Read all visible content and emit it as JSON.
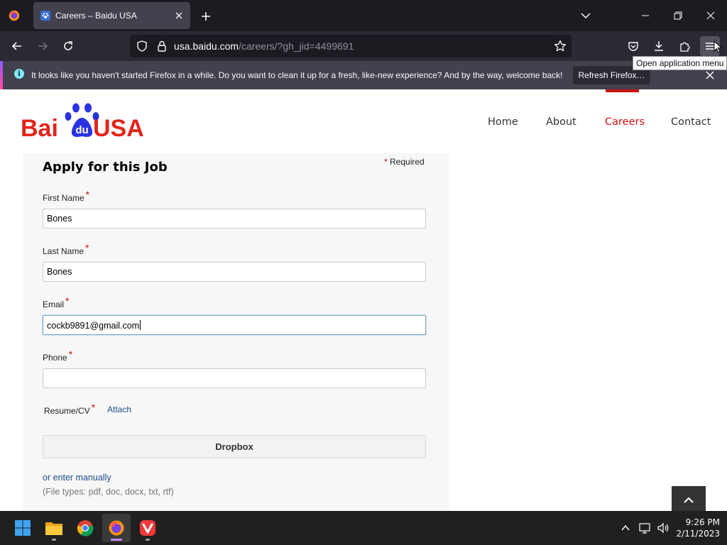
{
  "browser": {
    "tab": {
      "title": "Careers – Baidu USA",
      "favicon": "baidu-paw-icon"
    },
    "url": {
      "host": "usa.baidu.com",
      "path": "/careers/?gh_jid=4499691"
    },
    "tooltip": "Open application menu",
    "notification": {
      "message": "It looks like you haven't started Firefox in a while. Do you want to clean it up for a fresh, like-new experience? And by the way, welcome back!",
      "button": "Refresh Firefox…"
    }
  },
  "site": {
    "logo": {
      "part1": "Bai",
      "part2": "du",
      "part3": "USA"
    },
    "nav": [
      {
        "label": "Home"
      },
      {
        "label": "About"
      },
      {
        "label": "Careers",
        "active": true
      },
      {
        "label": "Contact"
      }
    ]
  },
  "form": {
    "title": "Apply for this Job",
    "required_star": "*",
    "required_label": "Required",
    "fields": [
      {
        "label": "First Name",
        "value": "Bones"
      },
      {
        "label": "Last Name",
        "value": "Bones"
      },
      {
        "label": "Email",
        "value": "cockb9891@gmail.com",
        "focused": true
      },
      {
        "label": "Phone",
        "value": ""
      }
    ],
    "resume": {
      "label": "Resume/CV",
      "attach": "Attach"
    },
    "dropbox": "Dropbox",
    "manual_link": "or enter manually",
    "file_types": "(File types: pdf, doc, docx, txt, rtf)"
  },
  "taskbar": {
    "apps": [
      "start-icon",
      "file-explorer-icon",
      "chrome-icon",
      "firefox-icon",
      "vivaldi-icon"
    ],
    "time": "9:26 PM",
    "date": "2/11/2023"
  },
  "colors": {
    "accent_red": "#cc1111",
    "logo_red": "#e1251b",
    "logo_blue": "#2932e1",
    "link_blue": "#1e4e8c"
  }
}
